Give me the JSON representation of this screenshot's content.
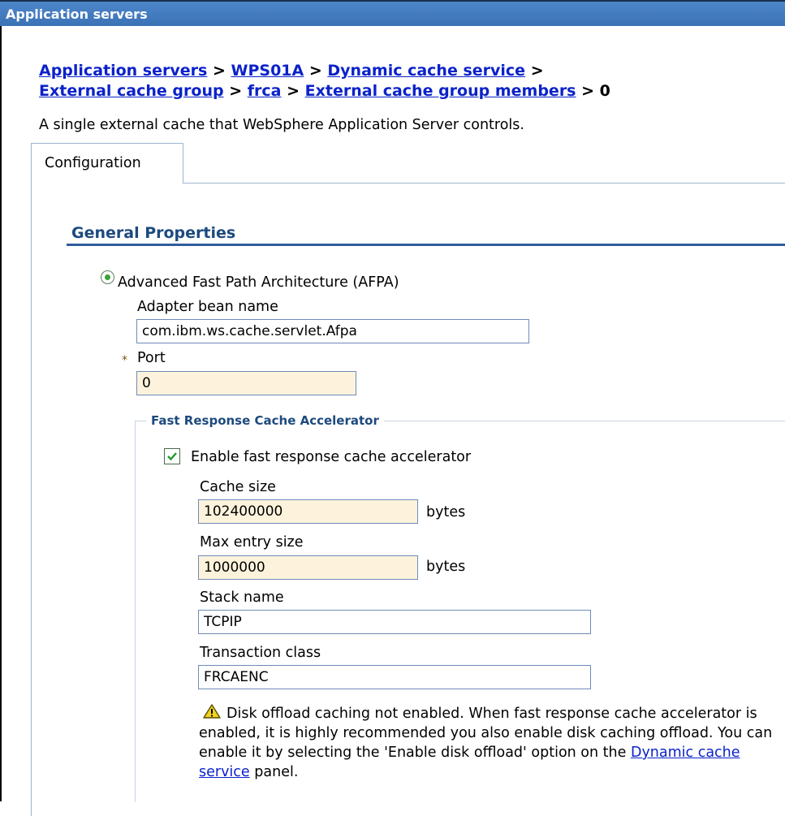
{
  "titlebar": {
    "title": "Application servers"
  },
  "breadcrumb": {
    "items": [
      "Application servers",
      "WPS01A",
      "Dynamic cache service",
      "External cache group",
      "frca",
      "External cache group members"
    ],
    "separator": ">",
    "current": "0"
  },
  "description": "A single external cache that WebSphere Application Server controls.",
  "tabs": {
    "configuration": "Configuration"
  },
  "general": {
    "title": "General Properties",
    "afpa_label": "Advanced Fast Path Architecture (AFPA)",
    "adapter_label": "Adapter bean name",
    "adapter_value": "com.ibm.ws.cache.servlet.Afpa",
    "required_mark": "*",
    "port_label": "Port",
    "port_value": "0"
  },
  "frca": {
    "legend": "Fast Response Cache Accelerator",
    "enable_label": "Enable fast response cache accelerator",
    "cache_size_label": "Cache size",
    "cache_size_value": "102400000",
    "bytes_unit": "bytes",
    "max_entry_label": "Max entry size",
    "max_entry_value": "1000000",
    "stack_label": "Stack name",
    "stack_value": "TCPIP",
    "transaction_label": "Transaction class",
    "transaction_value": "FRCAENC"
  },
  "warning": {
    "text": "Disk offload caching not enabled. When fast response cache accelerator is enabled, it is highly recommended you also enable disk caching offload. You can enable it by selecting the 'Enable disk offload' option on the",
    "link": "Dynamic cache service",
    "tail": "panel."
  },
  "colors": {
    "titlebar": "#3b72b6",
    "link": "#0b22c9",
    "required_field": "#fdf3dc",
    "section_title": "#1d4a7e"
  }
}
